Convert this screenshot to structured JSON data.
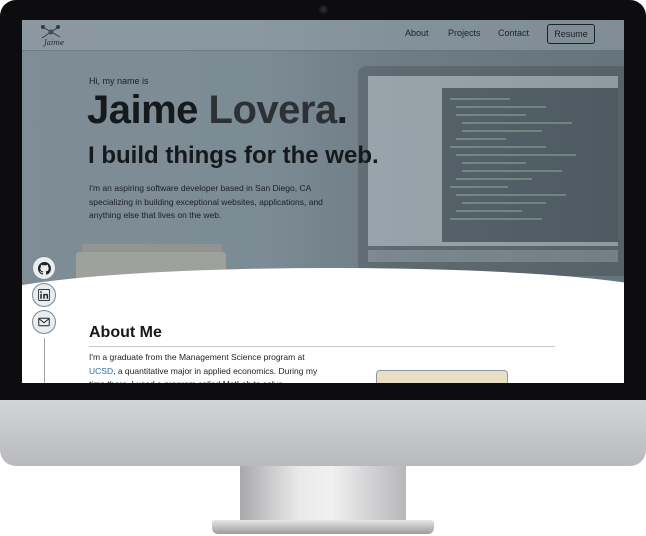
{
  "nav": {
    "logo_alt": "Jaime",
    "links": [
      "About",
      "Projects",
      "Contact"
    ],
    "resume_label": "Resume"
  },
  "hero": {
    "greeting": "Hi, my name is",
    "first_name": "Jaime",
    "last_name": "Lovera",
    "dot": ".",
    "tagline": "I build things for the web.",
    "intro": "I'm an aspiring software developer based in San Diego, CA specializing in building exceptional websites, applications, and anything else that lives on the web."
  },
  "social": [
    "github-icon",
    "linkedin-icon",
    "mail-icon"
  ],
  "about": {
    "title": "About Me",
    "text_before": "I'm a graduate from the Management Science program at ",
    "link": "UCSD",
    "text_after": ", a quantitative major in applied economics. During my time there, I used a program called MatLab to solve"
  }
}
